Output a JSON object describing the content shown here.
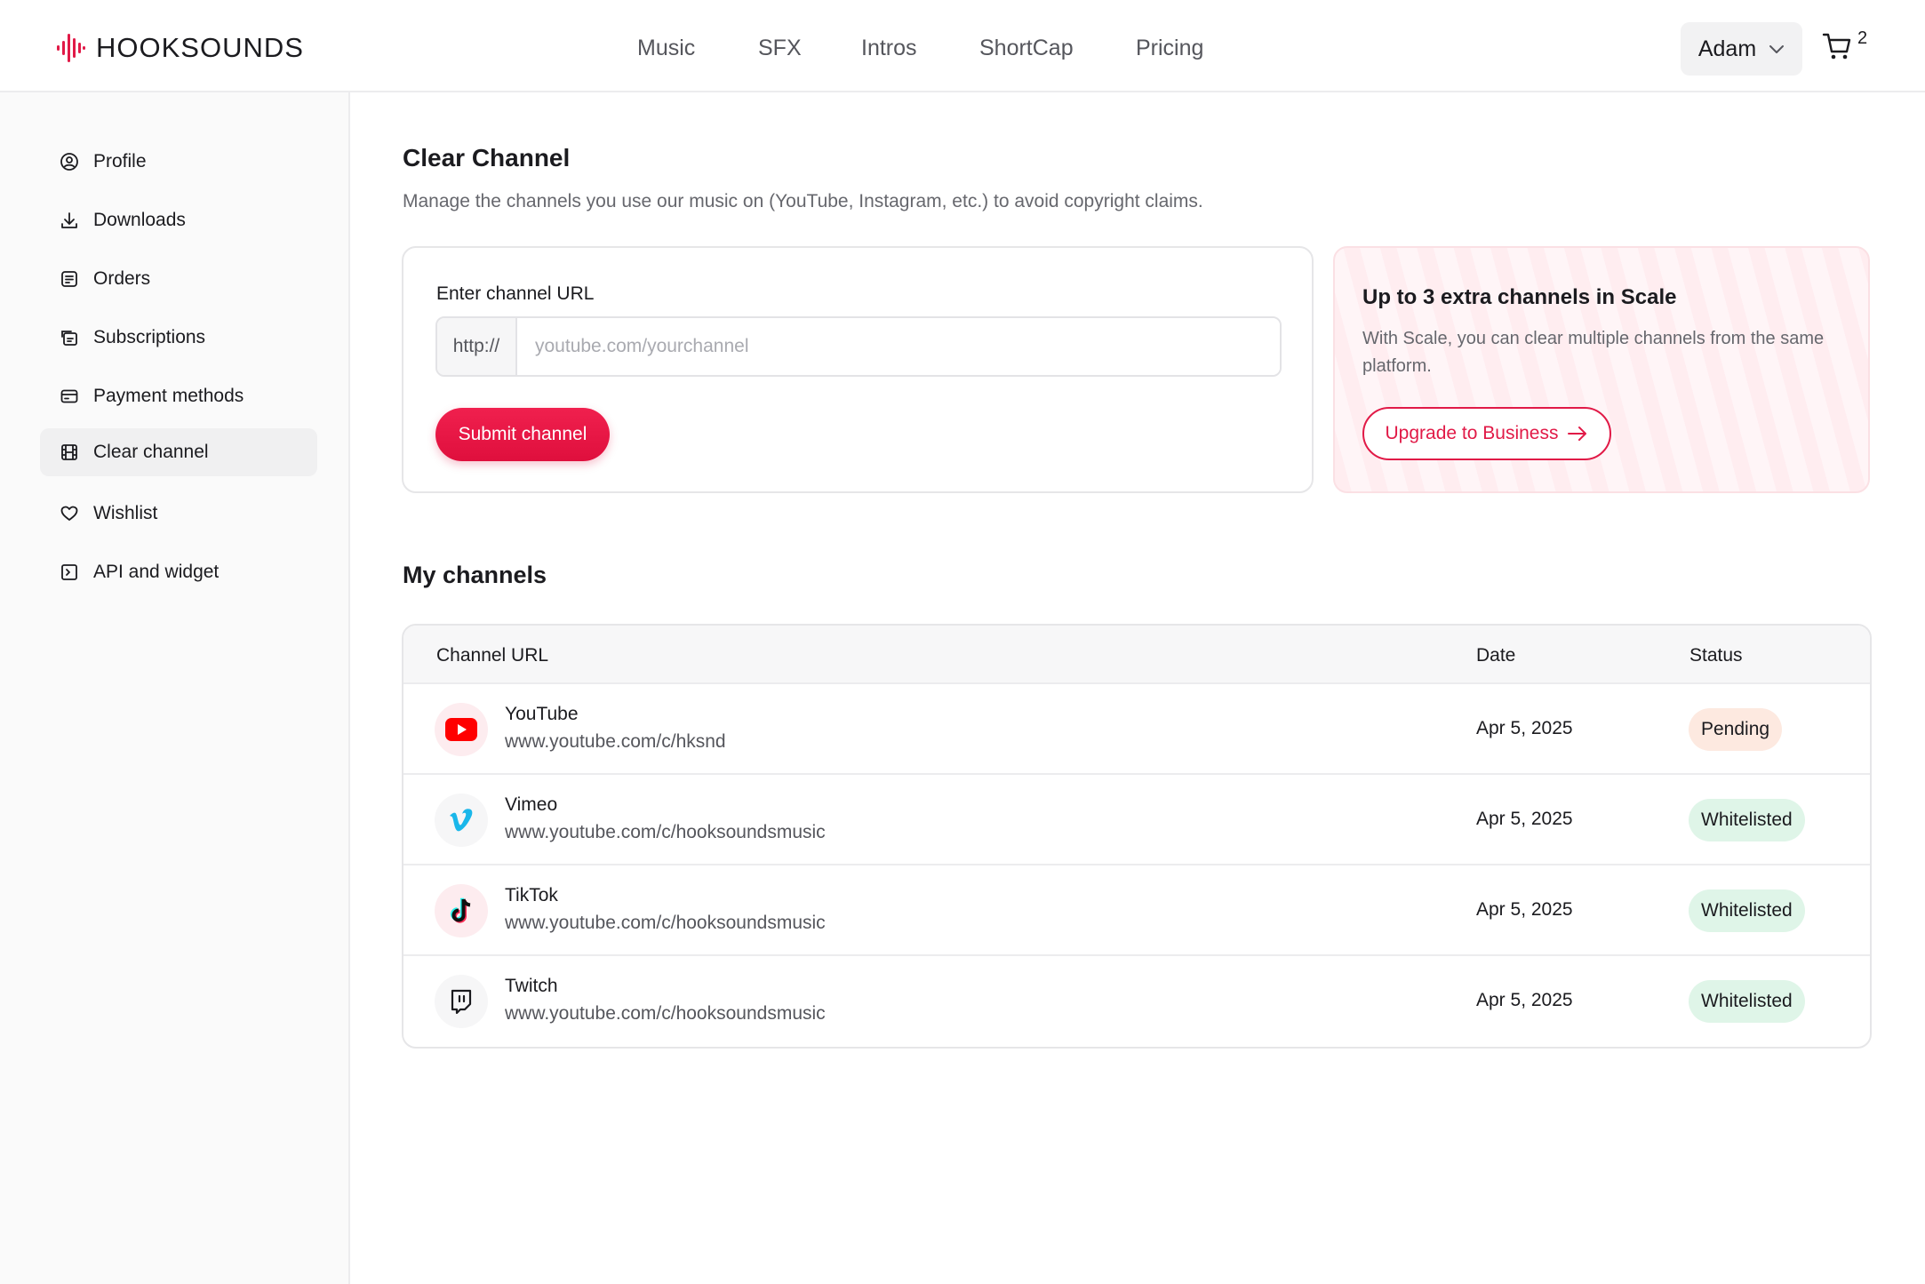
{
  "brand": {
    "name": "HOOKSOUNDS",
    "accent": "#e11a47"
  },
  "nav": {
    "items": [
      {
        "label": "Music"
      },
      {
        "label": "SFX"
      },
      {
        "label": "Intros"
      },
      {
        "label": "ShortCap"
      },
      {
        "label": "Pricing"
      }
    ]
  },
  "user": {
    "name": "Adam",
    "cart_count": "2"
  },
  "sidebar": {
    "items": [
      {
        "label": "Profile",
        "icon": "user-circle-icon"
      },
      {
        "label": "Downloads",
        "icon": "download-icon"
      },
      {
        "label": "Orders",
        "icon": "receipt-icon"
      },
      {
        "label": "Subscriptions",
        "icon": "refresh-card-icon"
      },
      {
        "label": "Payment methods",
        "icon": "credit-card-icon"
      },
      {
        "label": "Clear channel",
        "icon": "film-icon",
        "active": true
      },
      {
        "label": "Wishlist",
        "icon": "heart-icon"
      },
      {
        "label": "API and widget",
        "icon": "terminal-icon"
      }
    ]
  },
  "main": {
    "title": "Clear Channel",
    "description": "Manage the channels you use our music on (YouTube, Instagram, etc.) to avoid copyright claims.",
    "form": {
      "label": "Enter channel URL",
      "prefix": "http://",
      "placeholder": "youtube.com/yourchannel",
      "value": "",
      "submit_label": "Submit channel"
    },
    "upgrade": {
      "title": "Up to 3 extra channels in Scale",
      "description": "With Scale, you can clear multiple channels from the same platform.",
      "button_label": "Upgrade to Business"
    },
    "channels_title": "My channels",
    "table": {
      "headers": {
        "url": "Channel URL",
        "date": "Date",
        "status": "Status"
      },
      "rows": [
        {
          "platform": "YouTube",
          "url": "www.youtube.com/c/hksnd",
          "date": "Apr 5, 2025",
          "status": "Pending",
          "icon": "youtube-icon"
        },
        {
          "platform": "Vimeo",
          "url": "www.youtube.com/c/hooksoundsmusic",
          "date": "Apr 5, 2025",
          "status": "Whitelisted",
          "icon": "vimeo-icon"
        },
        {
          "platform": "TikTok",
          "url": "www.youtube.com/c/hooksoundsmusic",
          "date": "Apr 5, 2025",
          "status": "Whitelisted",
          "icon": "tiktok-icon"
        },
        {
          "platform": "Twitch",
          "url": "www.youtube.com/c/hooksoundsmusic",
          "date": "Apr 5, 2025",
          "status": "Whitelisted",
          "icon": "twitch-icon"
        }
      ]
    }
  }
}
